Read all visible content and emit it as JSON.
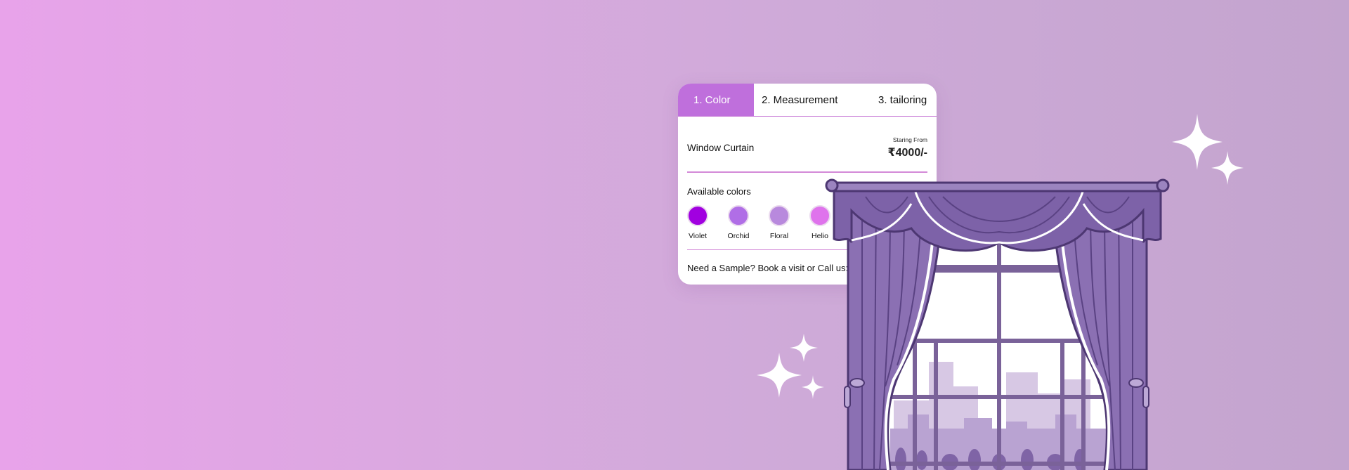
{
  "tabs": [
    {
      "label": "1. Color",
      "active": true
    },
    {
      "label": "2. Measurement",
      "active": false
    },
    {
      "label": "3. tailoring",
      "active": false
    }
  ],
  "product": {
    "name": "Window Curtain",
    "price_label": "Staring From",
    "price": "₹4000/-"
  },
  "colors": {
    "title": "Available colors",
    "items": [
      {
        "name": "Violet",
        "hex": "#a100e0"
      },
      {
        "name": "Orchid",
        "hex": "#b06ee6"
      },
      {
        "name": "Floral",
        "hex": "#b889dd"
      },
      {
        "name": "Helio",
        "hex": "#df73ec"
      }
    ]
  },
  "sample_text": "Need a Sample? Book a visit or Call us:",
  "accent": "#bf6fdc",
  "icons": [
    "sparkle-icon",
    "curtain-window-illustration"
  ]
}
